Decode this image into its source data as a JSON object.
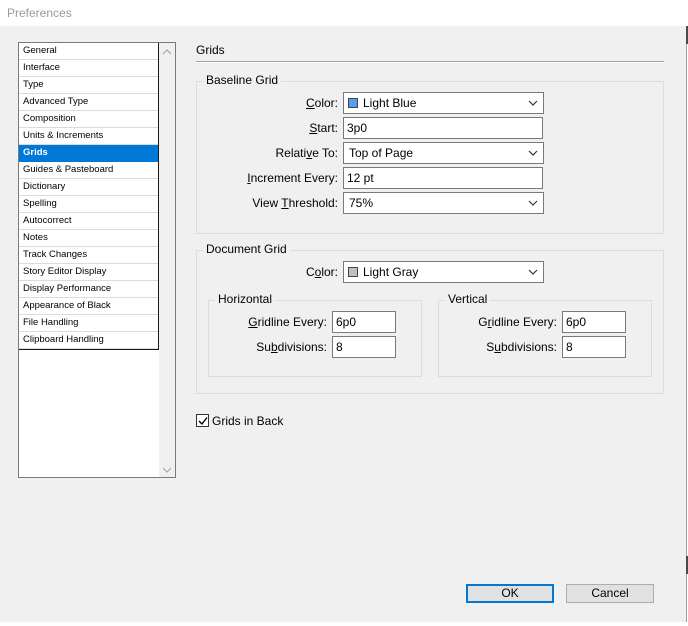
{
  "window": {
    "title": "Preferences"
  },
  "sidebar": {
    "items": [
      "General",
      "Interface",
      "Type",
      "Advanced Type",
      "Composition",
      "Units & Increments",
      "Grids",
      "Guides & Pasteboard",
      "Dictionary",
      "Spelling",
      "Autocorrect",
      "Notes",
      "Track Changes",
      "Story Editor Display",
      "Display Performance",
      "Appearance of Black",
      "File Handling",
      "Clipboard Handling"
    ],
    "selected": "Grids"
  },
  "panel": {
    "title": "Grids"
  },
  "baseline_grid": {
    "legend": "Baseline Grid",
    "color_label_pre": "",
    "color_label_u": "C",
    "color_label_post": "olor:",
    "color_value": "Light Blue",
    "color_swatch": "#5b9bf0",
    "start_label_pre": "",
    "start_label_u": "S",
    "start_label_post": "tart:",
    "start_value": "3p0",
    "relative_label_pre": "Relati",
    "relative_label_u": "v",
    "relative_label_post": "e To:",
    "relative_value": "Top of Page",
    "increment_label_pre": "",
    "increment_label_u": "I",
    "increment_label_post": "ncrement Every:",
    "increment_value": "12 pt",
    "threshold_label_pre": "View ",
    "threshold_label_u": "T",
    "threshold_label_post": "hreshold:",
    "threshold_value": "75%"
  },
  "document_grid": {
    "legend": "Document Grid",
    "color_label_pre": "C",
    "color_label_u": "o",
    "color_label_post": "lor:",
    "color_value": "Light Gray",
    "color_swatch": "#c0c0c0",
    "horizontal": {
      "legend": "Horizontal",
      "gridline_label_pre": "",
      "gridline_label_u": "G",
      "gridline_label_post": "ridline Every:",
      "gridline_value": "6p0",
      "subdiv_label_pre": "Su",
      "subdiv_label_u": "b",
      "subdiv_label_post": "divisions:",
      "subdiv_value": "8"
    },
    "vertical": {
      "legend": "Vertical",
      "gridline_label_pre": "G",
      "gridline_label_u": "r",
      "gridline_label_post": "idline Every:",
      "gridline_value": "6p0",
      "subdiv_label_pre": "S",
      "subdiv_label_u": "u",
      "subdiv_label_post": "bdivisions:",
      "subdiv_value": "8"
    }
  },
  "grids_in_back": {
    "label": "Grids in Back",
    "checked": true
  },
  "buttons": {
    "ok": "OK",
    "cancel": "Cancel"
  },
  "colors": {
    "selection": "#0078d7",
    "dialog_bg": "#f0f0f0"
  }
}
